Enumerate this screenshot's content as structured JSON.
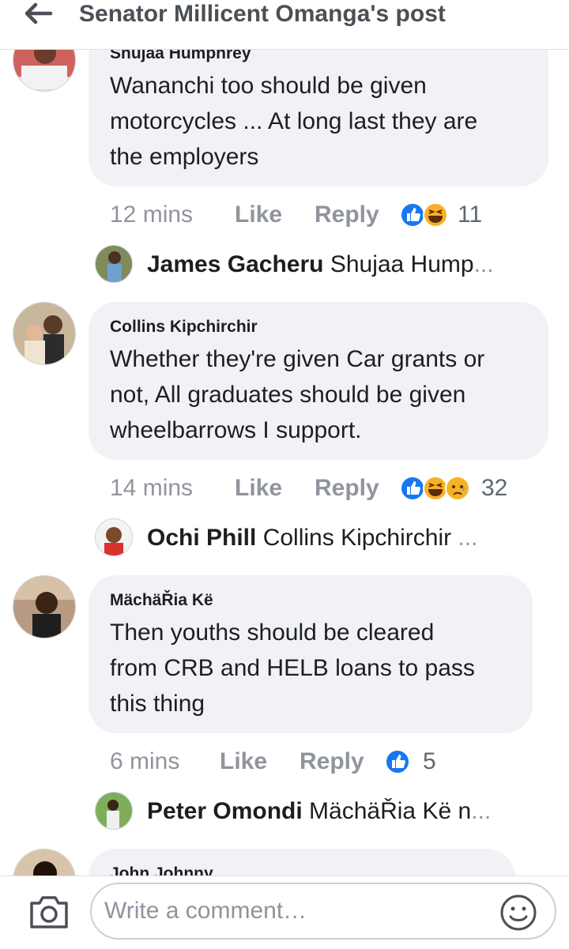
{
  "header": {
    "title": "Senator Millicent Omanga's post"
  },
  "comments": [
    {
      "author": "Shujaa Humphrey",
      "lines": [
        "Wananchi too should be given",
        "motorcycles ... At long last they are",
        "the employers"
      ],
      "time": "12 mins",
      "like": "Like",
      "reply": "Reply",
      "reaction_count": "11",
      "reactions": [
        "like-icon",
        "laugh-icon"
      ],
      "reply_author": "James Gacheru",
      "reply_preview": "Shujaa Hump",
      "ellipsis": "..."
    },
    {
      "author": "Collins Kipchirchir",
      "lines": [
        "Whether they're given Car grants or",
        "not,  All graduates should be given",
        "wheelbarrows I support."
      ],
      "time": "14 mins",
      "like": "Like",
      "reply": "Reply",
      "reaction_count": "32",
      "reactions": [
        "like-icon",
        "laugh-icon",
        "sad-icon"
      ],
      "reply_author": "Ochi Phill",
      "reply_preview": "Collins Kipchirchir",
      "ellipsis": "..."
    },
    {
      "author": "MächäŘia Kë",
      "lines": [
        "Then youths should be cleared",
        "from CRB and HELB loans to pass",
        "this thing"
      ],
      "time": "6 mins",
      "like": "Like",
      "reply": "Reply",
      "reaction_count": "5",
      "reactions": [
        "like-icon"
      ],
      "reply_author": "Peter Omondi",
      "reply_preview": "MächäŘia Kë n",
      "ellipsis": "..."
    },
    {
      "author": "John Johnny"
    }
  ],
  "composer": {
    "placeholder": "Write a comment…"
  },
  "colors": {
    "like_blue": "#1877f2",
    "bubble": "#f0f2f5",
    "muted": "#90949c"
  }
}
